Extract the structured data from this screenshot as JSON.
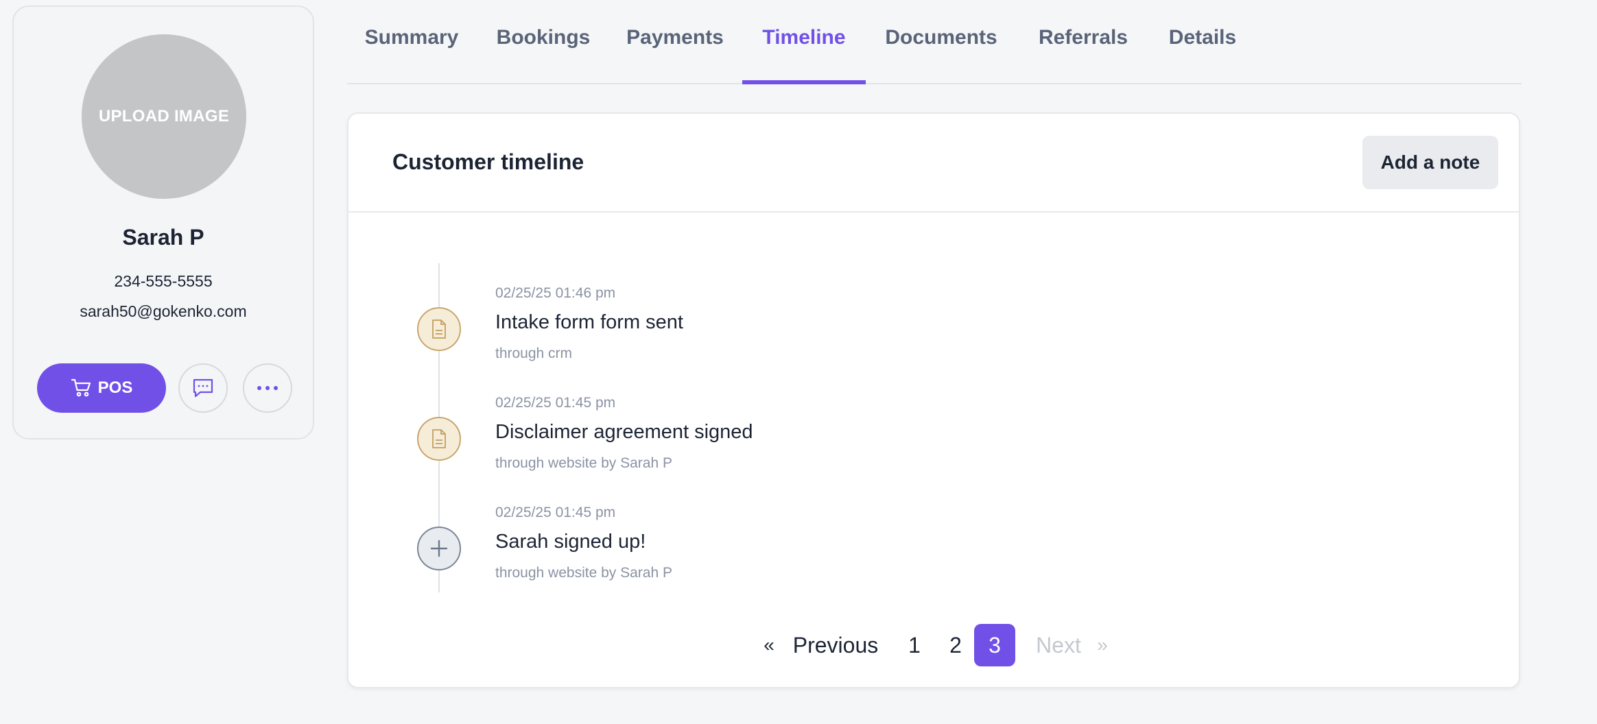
{
  "profile": {
    "upload_label": "UPLOAD IMAGE",
    "name": "Sarah P",
    "phone": "234-555-5555",
    "email": "sarah50@gokenko.com",
    "pos_label": "POS"
  },
  "tabs": [
    {
      "label": "Summary",
      "active": false
    },
    {
      "label": "Bookings",
      "active": false
    },
    {
      "label": "Payments",
      "active": false
    },
    {
      "label": "Timeline",
      "active": true
    },
    {
      "label": "Documents",
      "active": false
    },
    {
      "label": "Referrals",
      "active": false
    },
    {
      "label": "Details",
      "active": false
    }
  ],
  "timeline": {
    "title": "Customer timeline",
    "add_note_label": "Add a note",
    "events": [
      {
        "time": "02/25/25 01:46 pm",
        "title": "Intake form form sent",
        "source": "through crm",
        "icon": "document-icon"
      },
      {
        "time": "02/25/25 01:45 pm",
        "title": "Disclaimer agreement signed",
        "source": "through website by Sarah P",
        "icon": "document-icon"
      },
      {
        "time": "02/25/25 01:45 pm",
        "title": "Sarah signed up!",
        "source": "through website by Sarah P",
        "icon": "plus-icon"
      }
    ]
  },
  "pagination": {
    "first_symbol": "«",
    "previous_label": "Previous",
    "pages": [
      "1",
      "2",
      "3"
    ],
    "current_page": "3",
    "next_label": "Next",
    "last_symbol": "»"
  },
  "colors": {
    "accent": "#7150e8",
    "document_icon_bg": "#f6edd9",
    "document_icon_border": "#c9a66b",
    "avatar_bg": "#c4c5c7"
  }
}
